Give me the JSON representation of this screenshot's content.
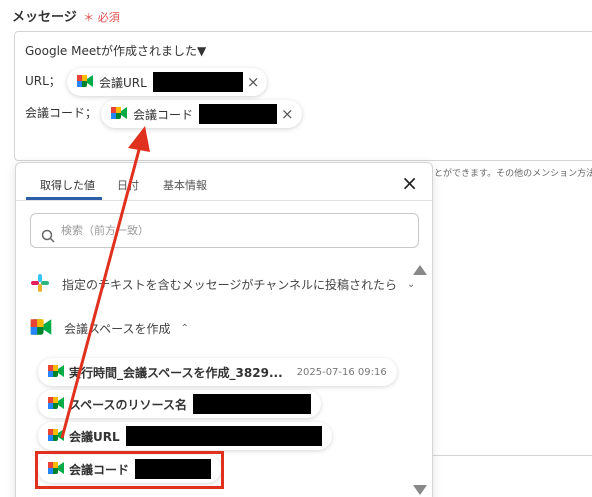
{
  "field": {
    "label": "メッセージ",
    "required": "必須"
  },
  "message": {
    "line1": "Google Meetが作成されました▼",
    "line2_prefix": "URL；",
    "line3_prefix": "会議コード；",
    "chip_url": "会議URL",
    "chip_code": "会議コード",
    "remove_glyph": "×"
  },
  "hint": "とができます。その他のメンション方法は",
  "panel": {
    "tabs": [
      "取得した値",
      "日付",
      "基本情報"
    ],
    "close_glyph": "×",
    "search_placeholder": "検索（前方一致）",
    "sections": [
      {
        "title": "指定のテキストを含むメッセージがチャンネルに投稿されたら",
        "chevron": "⌄"
      },
      {
        "title": "会議スペースを作成",
        "chevron": "⌃"
      }
    ],
    "items": [
      {
        "label": "実行時間_会議スペースを作成_3829...",
        "date": "2025-07-16 09:16"
      },
      {
        "label": "スペースのリソース名"
      },
      {
        "label": "会議URL"
      },
      {
        "label": "会議コード"
      }
    ]
  },
  "colors": {
    "accent": "#2b5fa8",
    "highlight": "#e0301e",
    "required": "#e05050"
  },
  "icons": [
    "google-meet-icon",
    "slack-icon",
    "search-icon",
    "close-icon",
    "chevron-icon",
    "scroll-arrow-icon"
  ]
}
